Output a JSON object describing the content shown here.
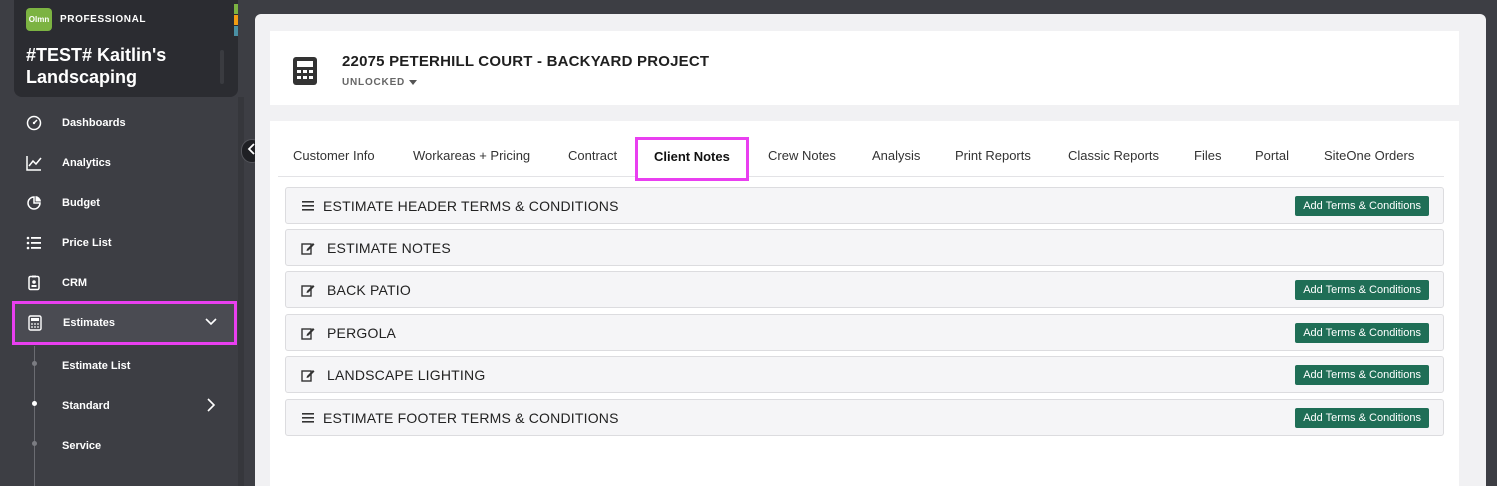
{
  "brand": {
    "logo_text": "Olmn",
    "tier": "PROFESSIONAL",
    "company": "#TEST# Kaitlin's Landscaping",
    "strip_colors": [
      "#7cb342",
      "#f39c12",
      "#4a90a4"
    ]
  },
  "nav": {
    "items": [
      {
        "label": "Dashboards",
        "icon": "dashboard-icon"
      },
      {
        "label": "Analytics",
        "icon": "analytics-icon"
      },
      {
        "label": "Budget",
        "icon": "pie-chart-icon"
      },
      {
        "label": "Price List",
        "icon": "list-icon"
      },
      {
        "label": "CRM",
        "icon": "id-badge-icon"
      },
      {
        "label": "Estimates",
        "icon": "calculator-icon"
      }
    ],
    "sub_items": [
      {
        "label": "Estimate List"
      },
      {
        "label": "Standard"
      },
      {
        "label": "Service"
      }
    ]
  },
  "project": {
    "title": "22075 PETERHILL COURT - BACKYARD PROJECT",
    "status": "UNLOCKED"
  },
  "tabs": [
    {
      "label": "Customer Info"
    },
    {
      "label": "Workareas + Pricing"
    },
    {
      "label": "Contract"
    },
    {
      "label": "Client Notes",
      "active": true
    },
    {
      "label": "Crew Notes"
    },
    {
      "label": "Analysis"
    },
    {
      "label": "Print Reports"
    },
    {
      "label": "Classic Reports"
    },
    {
      "label": "Files"
    },
    {
      "label": "Portal"
    },
    {
      "label": "SiteOne Orders"
    }
  ],
  "sections": [
    {
      "title": "ESTIMATE HEADER TERMS & CONDITIONS",
      "icon": "menu-lines-icon",
      "button": "Add Terms & Conditions"
    },
    {
      "title": "ESTIMATE NOTES",
      "icon": "edit-icon",
      "button": ""
    },
    {
      "title": "BACK PATIO",
      "icon": "edit-icon",
      "button": "Add Terms & Conditions"
    },
    {
      "title": "PERGOLA",
      "icon": "edit-icon",
      "button": "Add Terms & Conditions"
    },
    {
      "title": "LANDSCAPE LIGHTING",
      "icon": "edit-icon",
      "button": "Add Terms & Conditions"
    },
    {
      "title": "ESTIMATE FOOTER TERMS & CONDITIONS",
      "icon": "menu-lines-icon",
      "button": "Add Terms & Conditions"
    }
  ],
  "colors": {
    "highlight": "#e93ff0",
    "button_green": "#1f6e56",
    "sidebar_bg": "#3d3e44"
  }
}
